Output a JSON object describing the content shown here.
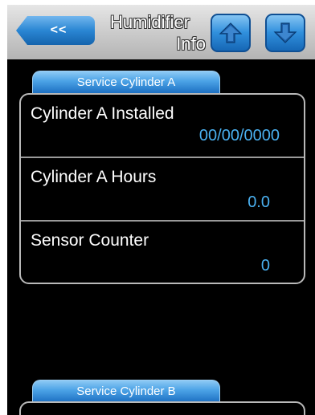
{
  "header": {
    "back_label": "<<",
    "title_line1": "Humidifier",
    "title_line2": "Info"
  },
  "tabs": {
    "cylinder_a": "Service Cylinder A",
    "cylinder_b": "Service Cylinder B"
  },
  "cylinder_a": {
    "rows": [
      {
        "label": "Cylinder A Installed",
        "value": "00/00/0000"
      },
      {
        "label": "Cylinder A Hours",
        "value": "0.0"
      },
      {
        "label": "Sensor Counter",
        "value": "0"
      }
    ]
  },
  "icons": {
    "back": "double-chevron-left-icon",
    "up": "arrow-up-icon",
    "down": "arrow-down-icon"
  },
  "colors": {
    "accent_blue": "#2a86d3",
    "value_text": "#4ab0f0",
    "panel_border": "#b9b9b9",
    "background": "#000000"
  }
}
